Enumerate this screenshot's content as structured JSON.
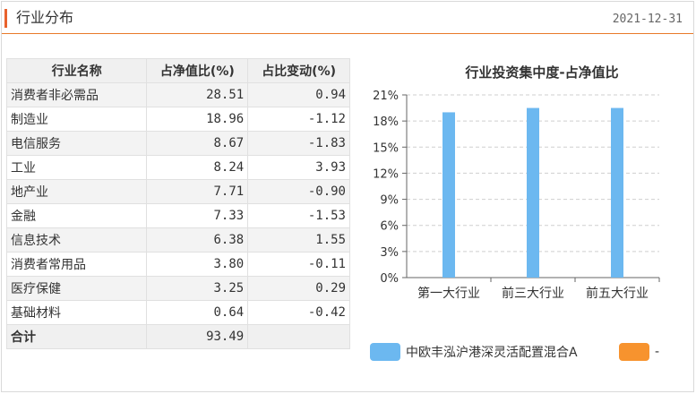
{
  "header": {
    "title": "行业分布",
    "date": "2021-12-31"
  },
  "table": {
    "columns": [
      "行业名称",
      "占净值比(%)",
      "占比变动(%)"
    ],
    "rows": [
      {
        "name": "消费者非必需品",
        "ratio": "28.51",
        "change": "0.94",
        "dir": "up"
      },
      {
        "name": "制造业",
        "ratio": "18.96",
        "change": "-1.12",
        "dir": "down"
      },
      {
        "name": "电信服务",
        "ratio": "8.67",
        "change": "-1.83",
        "dir": "down"
      },
      {
        "name": "工业",
        "ratio": "8.24",
        "change": "3.93",
        "dir": "up"
      },
      {
        "name": "地产业",
        "ratio": "7.71",
        "change": "-0.90",
        "dir": "down"
      },
      {
        "name": "金融",
        "ratio": "7.33",
        "change": "-1.53",
        "dir": "down"
      },
      {
        "name": "信息技术",
        "ratio": "6.38",
        "change": "1.55",
        "dir": "up"
      },
      {
        "name": "消费者常用品",
        "ratio": "3.80",
        "change": "-0.11",
        "dir": "down"
      },
      {
        "name": "医疗保健",
        "ratio": "3.25",
        "change": "0.29",
        "dir": "up"
      },
      {
        "name": "基础材料",
        "ratio": "0.64",
        "change": "-0.42",
        "dir": "down"
      }
    ],
    "total": {
      "name": "合计",
      "ratio": "93.49",
      "change": ""
    }
  },
  "colors": {
    "accent": "#e8612c",
    "up": "#e02020",
    "down": "#2e9b3a",
    "series1": "#6cb8f0",
    "series2": "#f7932e"
  },
  "chart_data": {
    "type": "bar",
    "title": "行业投资集中度-占净值比",
    "categories": [
      "第一大行业",
      "前三大行业",
      "前五大行业"
    ],
    "series": [
      {
        "name": "中欧丰泓沪港深灵活配置混合A",
        "values": [
          19.0,
          19.5,
          19.5
        ]
      },
      {
        "name": "-",
        "values": []
      }
    ],
    "ylim": [
      0,
      21
    ],
    "yticks": [
      "0%",
      "3%",
      "6%",
      "9%",
      "12%",
      "15%",
      "18%",
      "21%"
    ],
    "grid": true,
    "legend": "bottom"
  }
}
